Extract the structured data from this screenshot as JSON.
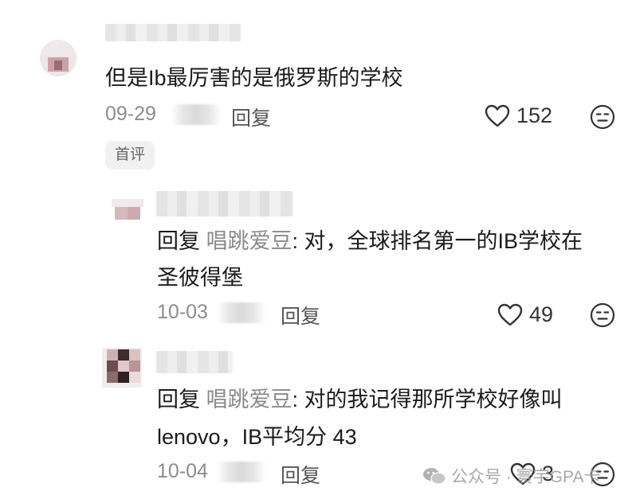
{
  "comments": [
    {
      "text": "但是Ib最厉害的是俄罗斯的学校",
      "date": "09-29",
      "reply_label": "回复",
      "likes": "152",
      "badge": "首评"
    }
  ],
  "replies": [
    {
      "prefix": "回复",
      "mention": "唱跳爱豆",
      "line1": ": 对，全球排名第一的IB学校在",
      "line2": "圣彼得堡",
      "date": "10-03",
      "reply_label": "回复",
      "likes": "49"
    },
    {
      "prefix": "回复",
      "mention": "唱跳爱豆",
      "line1": ": 对的我记得那所学校好像叫",
      "line2": "lenovo，IB平均分 43",
      "date": "10-04",
      "reply_label": "回复",
      "likes": "3"
    }
  ],
  "watermark": {
    "text": "公众号 · 寰宇GPA卡"
  },
  "colors": {
    "text": "#1b1b1b",
    "meta": "#8c8c8c",
    "mention": "#8a8a8a",
    "badge_bg": "#f1f1f1"
  },
  "icons": [
    "heart-icon",
    "neutral-face-icon",
    "wechat-icon"
  ]
}
